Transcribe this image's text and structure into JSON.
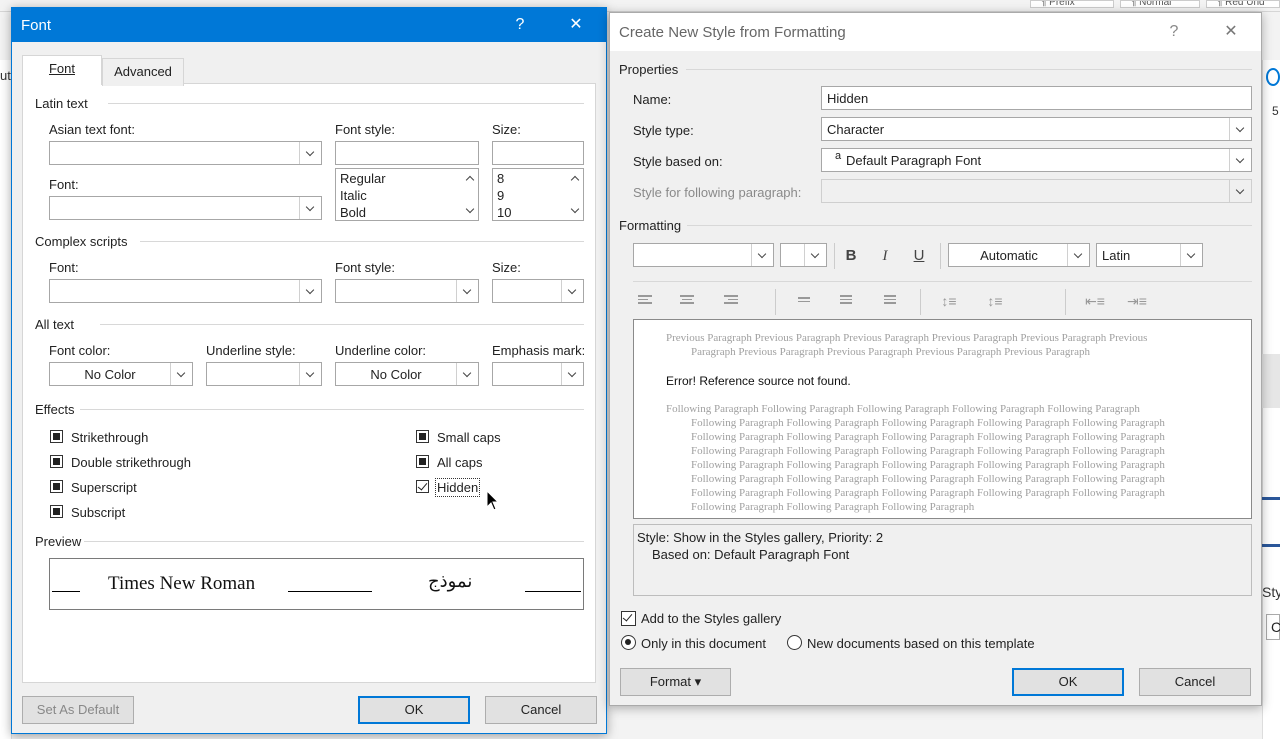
{
  "font_dialog": {
    "title": "Font",
    "help": "?",
    "close": "✕",
    "tabs": [
      "Font",
      "Advanced"
    ],
    "latin_section": "Latin text",
    "asian_font_label": "Asian text font:",
    "font_label": "Font:",
    "font_style_label": "Font style:",
    "size_label": "Size:",
    "style_options": [
      "Regular",
      "Italic",
      "Bold"
    ],
    "size_options": [
      "8",
      "9",
      "10"
    ],
    "complex_section": "Complex scripts",
    "cs_font_label": "Font:",
    "cs_style_label": "Font style:",
    "cs_size_label": "Size:",
    "all_text_section": "All text",
    "font_color_label": "Font color:",
    "font_color_value": "No Color",
    "underline_style_label": "Underline style:",
    "underline_color_label": "Underline color:",
    "underline_color_value": "No Color",
    "emphasis_label": "Emphasis mark:",
    "effects_section": "Effects",
    "effects_left": [
      "Strikethrough",
      "Double strikethrough",
      "Superscript",
      "Subscript"
    ],
    "effects_right": [
      "Small caps",
      "All caps",
      "Hidden"
    ],
    "preview_section": "Preview",
    "preview_latin": "Times New Roman",
    "preview_arabic": "نموذج",
    "set_default": "Set As Default",
    "ok": "OK",
    "cancel": "Cancel"
  },
  "style_dialog": {
    "title": "Create New Style from Formatting",
    "help": "?",
    "close": "✕",
    "properties_section": "Properties",
    "name_label": "Name:",
    "name_value": "Hidden",
    "style_type_label": "Style type:",
    "style_type_value": "Character",
    "based_on_label": "Style based on:",
    "based_on_icon": "a",
    "based_on_value": "Default Paragraph Font",
    "following_label": "Style for following paragraph:",
    "formatting_section": "Formatting",
    "bold": "B",
    "italic": "I",
    "underline": "U",
    "color_value": "Automatic",
    "script_value": "Latin",
    "preview_previous": "Previous Paragraph Previous Paragraph Previous Paragraph Previous Paragraph Previous Paragraph Previous",
    "preview_previous2": "Paragraph Previous Paragraph Previous Paragraph Previous Paragraph Previous Paragraph",
    "preview_main": "Error! Reference source not found.",
    "preview_following_first": "Following Paragraph Following Paragraph Following Paragraph Following Paragraph Following Paragraph",
    "preview_following_line": "Following Paragraph Following Paragraph Following Paragraph Following Paragraph Following Paragraph",
    "preview_following_last": "Following Paragraph Following Paragraph Following Paragraph",
    "description_line1": "Style: Show in the Styles gallery, Priority: 2",
    "description_line2": "Based on: Default Paragraph Font",
    "add_gallery": "Add to the Styles gallery",
    "only_doc": "Only in this document",
    "new_docs": "New documents based on this template",
    "format_btn": "Format ▾",
    "ok": "OK",
    "cancel": "Cancel"
  },
  "background": {
    "ribbon_styles": [
      "¶ Prefix",
      "¶ Normal",
      "¶ Red Und"
    ],
    "side_text_left": "ut",
    "side_text_right1": "5",
    "side_text_right2": "Sty",
    "side_text_right3": "C"
  }
}
